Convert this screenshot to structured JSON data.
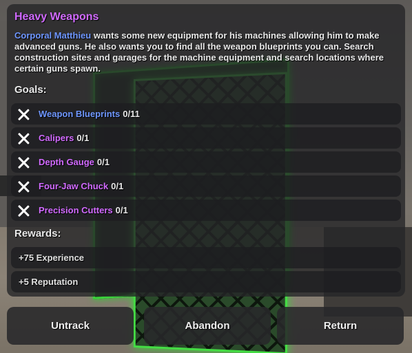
{
  "quest": {
    "title": "Heavy Weapons",
    "description_npc": "Corporal Matthieu",
    "description_text": " wants some new equipment for his machines allowing him to make advanced guns. He also wants you to find all the weapon blueprints you can. Search construction sites and garages for the machine equipment and search locations where certain guns spawn."
  },
  "goals": {
    "label": "Goals:",
    "items": [
      {
        "name": "Weapon Blueprints",
        "count": "0/11",
        "color": "#6f97ff",
        "status_icon": "x-icon"
      },
      {
        "name": "Calipers",
        "count": "0/1",
        "color": "#d16aff",
        "status_icon": "x-icon"
      },
      {
        "name": "Depth Gauge",
        "count": "0/1",
        "color": "#d16aff",
        "status_icon": "x-icon"
      },
      {
        "name": "Four-Jaw Chuck",
        "count": "0/1",
        "color": "#d16aff",
        "status_icon": "x-icon"
      },
      {
        "name": "Precision Cutters",
        "count": "0/1",
        "color": "#d16aff",
        "status_icon": "x-icon"
      }
    ]
  },
  "rewards": {
    "label": "Rewards:",
    "items": [
      "+75 Experience",
      "+5 Reputation"
    ]
  },
  "buttons": {
    "untrack": "Untrack",
    "abandon": "Abandon",
    "return": "Return"
  },
  "colors": {
    "title": "#d16aff",
    "npc_name": "#6f97ff",
    "panel_bg": "#262628"
  }
}
